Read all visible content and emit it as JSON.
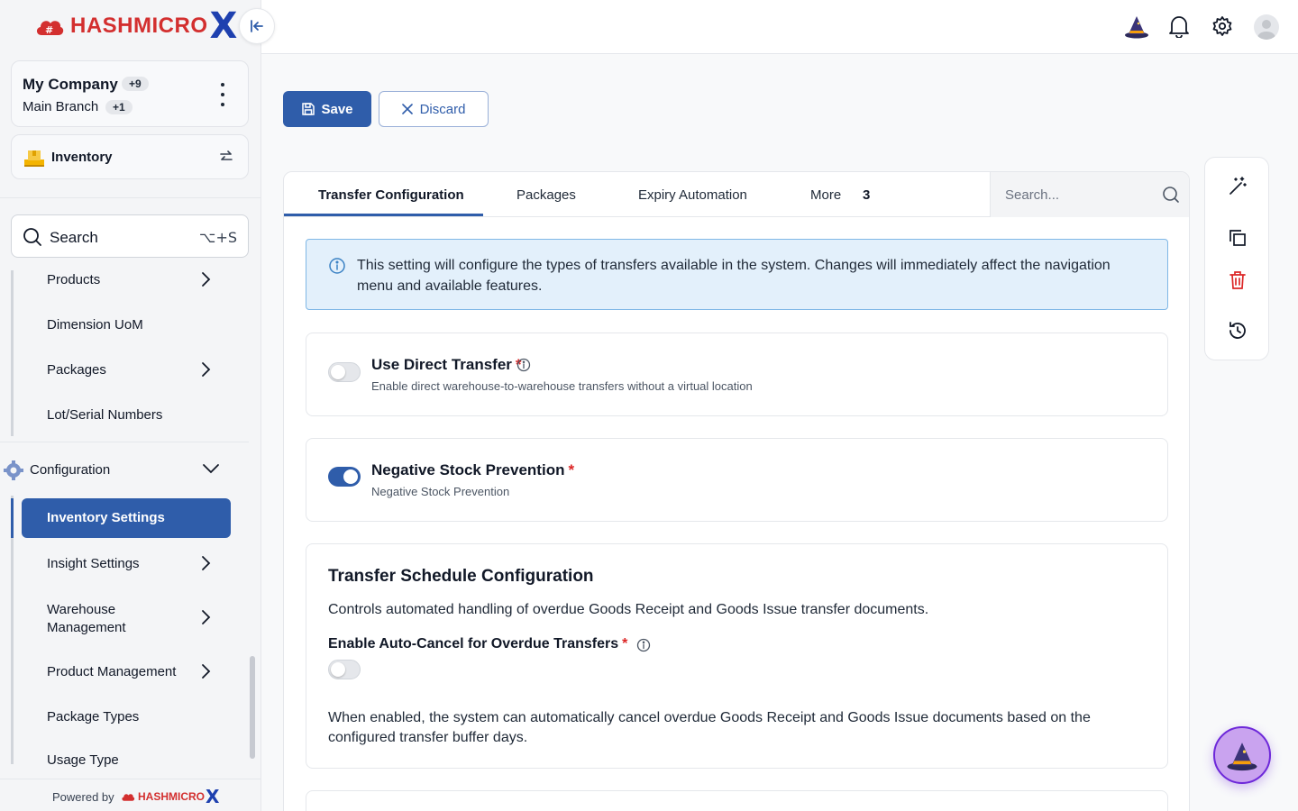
{
  "brand": {
    "name": "HASHMICRO",
    "mark": "X"
  },
  "company": {
    "name": "My Company",
    "count": "+9",
    "branch": "Main Branch",
    "branch_count": "+1"
  },
  "module": {
    "label": "Inventory"
  },
  "search": {
    "label": "Search",
    "shortcut": "⌥+S"
  },
  "nav": {
    "items_top": [
      "Products",
      "Dimension UoM",
      "Packages",
      "Lot/Serial Numbers"
    ],
    "config_label": "Configuration",
    "config_items": {
      "active": "Inventory Settings",
      "insight": "Insight Settings",
      "warehouse": "Warehouse Management",
      "product_mgmt": "Product Management",
      "package_types": "Package Types",
      "usage_type": "Usage Type"
    }
  },
  "powered": {
    "text": "Powered by",
    "brand": "HASHMICRO",
    "mark": "X"
  },
  "toolbar": {
    "save_label": "Save",
    "discard_label": "Discard"
  },
  "tabs": {
    "items": [
      "Transfer Configuration",
      "Packages",
      "Expiry Automation",
      "More"
    ],
    "more_count": "3",
    "search_placeholder": "Search..."
  },
  "info_banner": {
    "text": "This setting will configure the types of transfers available in the system. Changes will immediately affect the navigation menu and available features."
  },
  "settings": {
    "direct_transfer": {
      "title": "Use Direct Transfer",
      "required": "*",
      "desc": "Enable direct warehouse-to-warehouse transfers without a virtual location",
      "enabled": false
    },
    "negative_stock": {
      "title": "Negative Stock Prevention",
      "required": "*",
      "desc": "Negative Stock Prevention",
      "enabled": true
    },
    "schedule": {
      "title": "Transfer Schedule Configuration",
      "desc": "Controls automated handling of overdue Goods Receipt and Goods Issue transfer documents.",
      "auto_cancel_label": "Enable Auto-Cancel for Overdue Transfers",
      "required": "*",
      "auto_cancel_enabled": false,
      "note": "When enabled, the system can automatically cancel overdue Goods Receipt and Goods Issue documents based on the configured transfer buffer days."
    }
  },
  "colors": {
    "primary": "#2f5daa",
    "brand_red": "#d32f2f",
    "brand_blue": "#1e40af",
    "danger": "#dc2626",
    "info_bg": "#e3f0fb"
  }
}
